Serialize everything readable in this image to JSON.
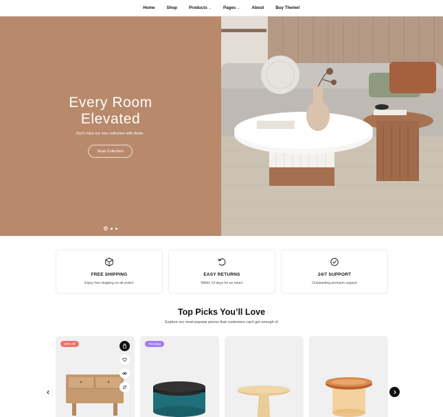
{
  "nav": {
    "items": [
      {
        "label": "Home",
        "dropdown": false
      },
      {
        "label": "Shop",
        "dropdown": false
      },
      {
        "label": "Products",
        "dropdown": true
      },
      {
        "label": "Pages",
        "dropdown": true
      },
      {
        "label": "About",
        "dropdown": false
      },
      {
        "label": "Buy Theme!",
        "dropdown": false
      }
    ]
  },
  "hero": {
    "title_line1": "Every Room",
    "title_line2": "Elevated",
    "subtitle": "Don't miss our new collection with deals..",
    "cta_label": "Shop Collection",
    "background_color": "#b8896a",
    "slides_count": 3,
    "active_slide": 1
  },
  "features": [
    {
      "icon": "box-icon",
      "title": "FREE SHIPPING",
      "desc": "Enjoy free shipping on all orders"
    },
    {
      "icon": "return-icon",
      "title": "EASY RETURNS",
      "desc": "Within 14 days for an return"
    },
    {
      "icon": "check-circle-icon",
      "title": "24/7 SUPPORT",
      "desc": "Outstanding premium support"
    }
  ],
  "top_picks": {
    "title": "Top Picks You’ll Love",
    "subtitle": "Explore our most popular pieces that customers can't get enough of"
  },
  "products": [
    {
      "badge": "20% Off",
      "badge_type": "sale",
      "item": "wooden-nightstand"
    },
    {
      "badge": "Trending",
      "badge_type": "trend",
      "item": "teal-ottoman"
    },
    {
      "badge": "",
      "badge_type": "",
      "item": "wooden-side-table"
    },
    {
      "badge": "",
      "badge_type": "",
      "item": "amber-glass-side-table"
    }
  ],
  "colors": {
    "sale": "#f0706a",
    "trending": "#a479f0",
    "accent_dark": "#111111"
  }
}
